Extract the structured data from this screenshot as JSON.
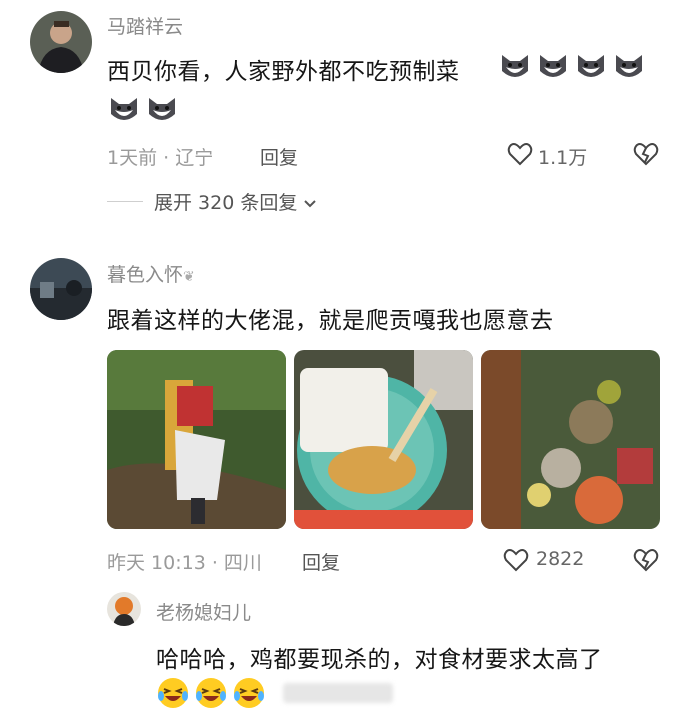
{
  "comments": [
    {
      "username": "马踏祥云",
      "text": "西贝你看，人家野外都不吃预制菜",
      "emoji": "husky-emoji",
      "time_location": "1天前 · 辽宁",
      "reply_label": "回复",
      "likes": "1.1万",
      "expand_label": "展开 320 条回复"
    },
    {
      "username": "暮色入怀",
      "text": "跟着这样的大佬混，就是爬贡嘎我也愿意去",
      "time_location": "昨天 10:13 · 四川",
      "reply_label": "回复",
      "likes": "2822"
    }
  ],
  "reply": {
    "username": "老杨媳妇儿",
    "text": "哈哈哈，鸡都要现杀的，对食材要求太高了",
    "emoji": "laughing-crying-emoji"
  },
  "icons": {
    "like": "heart-outline-icon",
    "dislike": "broken-heart-icon",
    "expand": "chevron-down-icon"
  },
  "colors": {
    "text": "#161616",
    "secondary": "#8a8a8a",
    "emoji_yellow": "#ffcc22"
  }
}
